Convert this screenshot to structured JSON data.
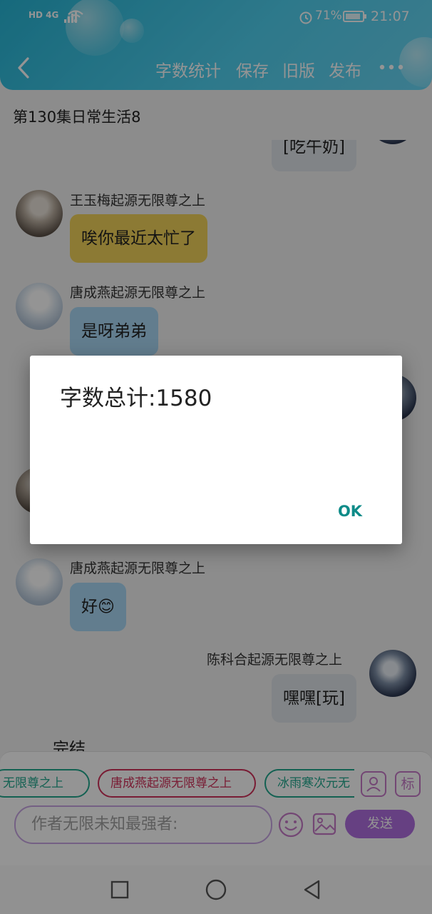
{
  "status_bar": {
    "network": "HD 4G",
    "battery_pct": "71%",
    "time": "21:07"
  },
  "toolbar": {
    "back_icon": "chevron-left-icon",
    "word_count": "字数统计",
    "save": "保存",
    "old_version": "旧版",
    "publish": "发布",
    "more_icon": "more-horizontal-icon"
  },
  "page_title": "第130集日常生活8",
  "messages": [
    {
      "side": "right",
      "sender": "",
      "text": "[吃午奶]",
      "partial": true
    },
    {
      "side": "left",
      "sender": "王玉梅起源无限尊之上",
      "text": "唉你最近太忙了",
      "color": "yellow"
    },
    {
      "side": "left",
      "sender": "唐成燕起源无限尊之上",
      "text": "是呀弟弟",
      "color": "blue"
    },
    {
      "side": "left",
      "sender": "唐成燕起源无限尊之上",
      "text": "好😊",
      "color": "blue"
    },
    {
      "side": "right",
      "sender": "陈科合起源无限尊之上",
      "text": "嘿嘿[玩]",
      "color": "gray"
    },
    {
      "side": "left",
      "sender": "",
      "text": "完结",
      "partial": true
    }
  ],
  "character_chips": [
    {
      "label": "无限尊之上",
      "color": "#22a88e"
    },
    {
      "label": "唐成燕起源无限尊之上",
      "color": "#d0315a"
    },
    {
      "label": "冰雨寒次元无",
      "color": "#22a88e"
    }
  ],
  "panel": {
    "person_icon": "person-icon",
    "mark_button": "标",
    "input_placeholder": "作者无限未知最强者:",
    "emoji_icon": "emoji-icon",
    "image_icon": "image-icon",
    "send": "发送"
  },
  "dialog": {
    "message": "字数总计:1580",
    "ok": "OK"
  },
  "nav_bar": {
    "recent_icon": "square-icon",
    "home_icon": "circle-icon",
    "back_icon": "triangle-back-icon"
  },
  "colors": {
    "header_accent": "#2fbfe0",
    "send_button": "#b06ee0",
    "ok_text": "#0d8b88"
  }
}
